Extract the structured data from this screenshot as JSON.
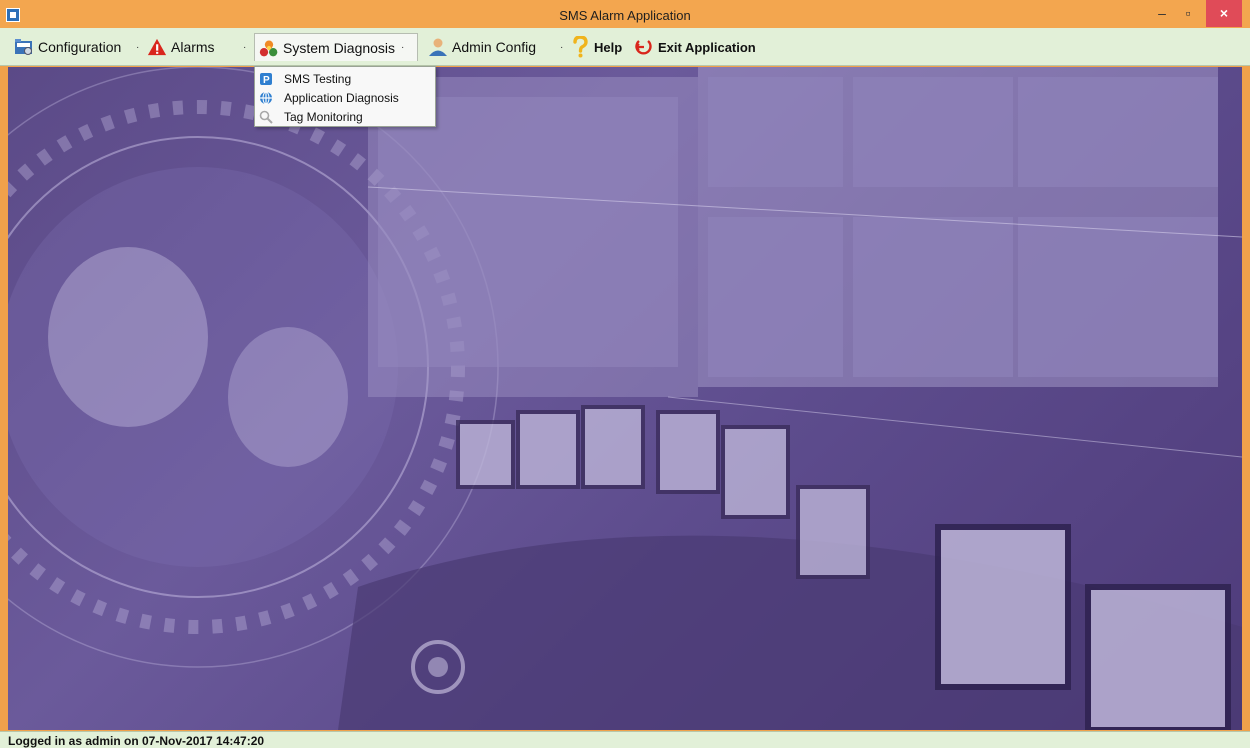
{
  "window": {
    "title": "SMS Alarm Application",
    "controls": {
      "minimize": "–",
      "restore": "▫",
      "close": "×"
    }
  },
  "toolbar": {
    "items": [
      {
        "label": "Configuration",
        "icon": "configuration-icon",
        "has_dropdown": true
      },
      {
        "label": "Alarms",
        "icon": "alarm-warning-icon",
        "has_dropdown": true
      },
      {
        "label": "System Diagnosis",
        "icon": "system-diagnosis-icon",
        "has_dropdown": true,
        "active": true
      },
      {
        "label": "Admin Config",
        "icon": "admin-user-icon",
        "has_dropdown": true
      },
      {
        "label": "Help",
        "icon": "help-question-icon"
      },
      {
        "label": "Exit Application",
        "icon": "exit-icon"
      }
    ],
    "dropdown_arrow": "▾",
    "separator": "·"
  },
  "dropdown": {
    "items": [
      {
        "label": "SMS Testing",
        "icon": "sms-testing-icon"
      },
      {
        "label": "Application Diagnosis",
        "icon": "globe-icon"
      },
      {
        "label": "Tag Monitoring",
        "icon": "magnifier-icon"
      }
    ]
  },
  "statusbar": {
    "text": "Logged in as admin on 07-Nov-2017 14:47:20"
  },
  "colors": {
    "titlebar": "#f3a64f",
    "toolbar": "#e2f0d8",
    "close_button": "#e04b58",
    "background_purple": "#5b4a87"
  }
}
